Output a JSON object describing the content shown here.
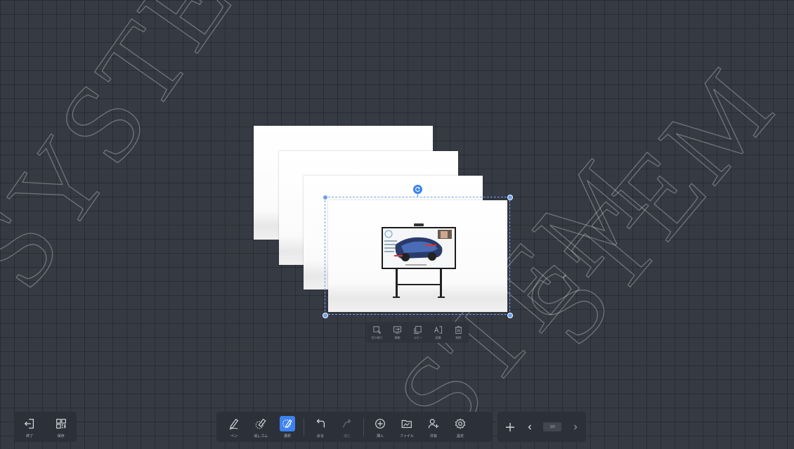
{
  "watermark": {
    "text_left": "SYSTE",
    "text_right": "STEM",
    "text_bottom": "STEM"
  },
  "colors": {
    "background": "#363a43",
    "accent": "#3d82f0",
    "toolbar": "#2c3038",
    "selection": "#6b9ef0"
  },
  "pages_stack_count": 4,
  "context_menu": [
    {
      "id": "crop",
      "label": "切り取り",
      "icon": "crop-icon"
    },
    {
      "id": "move",
      "label": "移動",
      "icon": "move-icon"
    },
    {
      "id": "copy",
      "label": "コピー",
      "icon": "copy-icon"
    },
    {
      "id": "text",
      "label": "認識",
      "icon": "text-recognize-icon"
    },
    {
      "id": "delete",
      "label": "削除",
      "icon": "trash-icon"
    }
  ],
  "left_tools": [
    {
      "label": "終了",
      "icon": "exit-icon"
    },
    {
      "label": "保存",
      "icon": "qr-save-icon"
    }
  ],
  "main_tools": {
    "pen": {
      "label": "ペン",
      "icon": "pen-icon"
    },
    "eraser": {
      "label": "消しゴム",
      "icon": "eraser-icon"
    },
    "select": {
      "label": "選択",
      "icon": "select-icon",
      "active": true
    },
    "undo": {
      "label": "戻る",
      "icon": "undo-icon"
    },
    "redo": {
      "label": "進む",
      "icon": "redo-icon",
      "disabled": true
    },
    "insert": {
      "label": "挿入",
      "icon": "insert-icon"
    },
    "file": {
      "label": "ファイル",
      "icon": "folder-icon"
    },
    "share": {
      "label": "共有",
      "icon": "share-user-icon"
    },
    "settings": {
      "label": "設定",
      "icon": "gear-icon"
    }
  },
  "nav": {
    "add_icon": "plus-icon",
    "prev_icon": "chevron-left-icon",
    "next_icon": "chevron-right-icon",
    "page": "2/2"
  }
}
